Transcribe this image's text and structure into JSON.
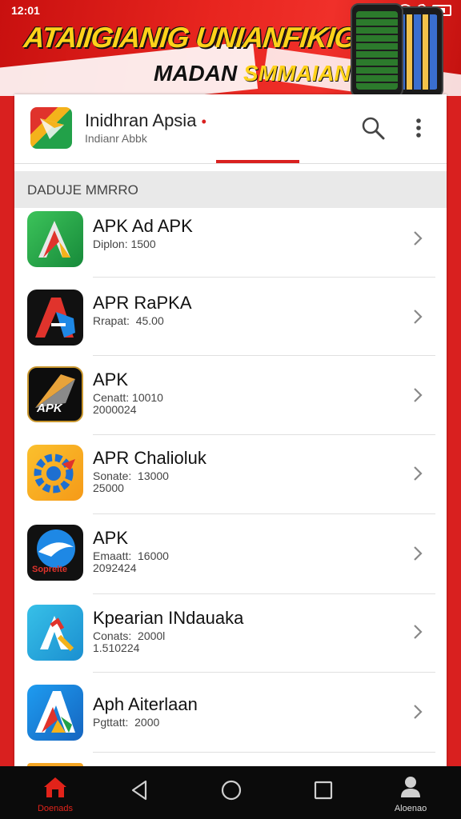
{
  "status": {
    "time": "12:01"
  },
  "banner": {
    "line1": "ATAIIGIANIG UNIANFIKIG",
    "line2a": "MADAN ",
    "line2b": "SMMAIAN!"
  },
  "header": {
    "title": "Inidhran Apsia",
    "title_mark": "•",
    "subtitle": "Indianr Abbk"
  },
  "section": {
    "label": "DADUJE MMRRO"
  },
  "apps": [
    {
      "name": "APK Ad APK",
      "meta": "Diplon: 1500",
      "icon": "green-a-icon"
    },
    {
      "name": "APR RaPKA",
      "meta": "Rrapat:  45.00",
      "icon": "red-a-icon"
    },
    {
      "name": "APK",
      "meta": "Cenatt: 10010\n2000024",
      "icon": "dark-apk-icon",
      "icon_text": "APK"
    },
    {
      "name": "APR Chalioluk",
      "meta": "Sonate:  13000\n25000",
      "icon": "yellow-gear-icon"
    },
    {
      "name": "APK",
      "meta": "Emaatt:  16000\n2092424",
      "icon": "blue-shark-icon",
      "icon_text": "Soprelte"
    },
    {
      "name": "Kpearian INdauaka",
      "meta": "Conats:  2000l\n1.510224",
      "icon": "tools-a-icon"
    },
    {
      "name": "Aph Aiterlaan",
      "meta": "Pgttatt:  2000",
      "icon": "blue-a-icon"
    }
  ],
  "nav": {
    "home_label": "Doenads",
    "profile_label": "Aloenao"
  },
  "colors": {
    "brand": "#d9201f",
    "nav_bg": "#0b0b0b"
  }
}
